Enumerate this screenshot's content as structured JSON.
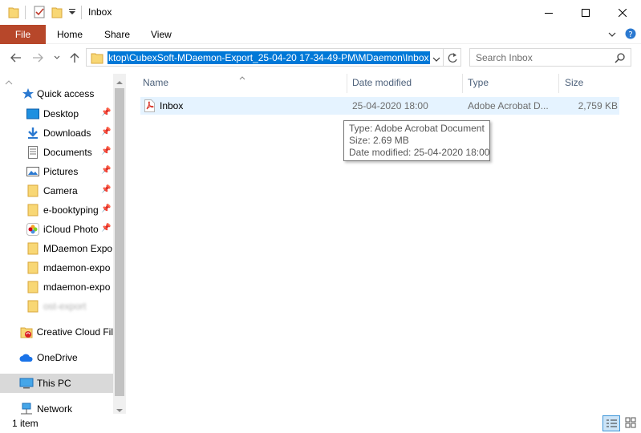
{
  "window": {
    "title": "Inbox"
  },
  "ribbon": {
    "tabs": [
      "File",
      "Home",
      "Share",
      "View"
    ]
  },
  "address": {
    "path": "ktop\\CubexSoft-MDaemon-Export_25-04-20 17-34-49-PM\\MDaemon\\Inbox"
  },
  "search": {
    "placeholder": "Search Inbox"
  },
  "nav": {
    "quick_access": "Quick access",
    "items": [
      "Desktop",
      "Downloads",
      "Documents",
      "Pictures",
      "Camera",
      "e-booktyping",
      "iCloud Photo",
      "MDaemon Expo",
      "mdaemon-expo",
      "mdaemon-expo",
      "ost-export"
    ],
    "creative_cloud": "Creative Cloud Fil",
    "onedrive": "OneDrive",
    "this_pc": "This PC",
    "network": "Network"
  },
  "columns": {
    "name": "Name",
    "date": "Date modified",
    "type": "Type",
    "size": "Size"
  },
  "files": [
    {
      "name": "Inbox",
      "date": "25-04-2020 18:00",
      "type": "Adobe Acrobat D...",
      "size": "2,759 KB"
    }
  ],
  "tooltip": {
    "type": "Type: Adobe Acrobat Document",
    "size": "Size: 2.69 MB",
    "date": "Date modified: 25-04-2020 18:00"
  },
  "status": {
    "count": "1 item"
  },
  "colors": {
    "file_tab": "#b7472a",
    "selection": "#0078d7",
    "row_hover": "#e5f3ff",
    "header_text": "#4c607a",
    "folder": "#f8d775"
  }
}
